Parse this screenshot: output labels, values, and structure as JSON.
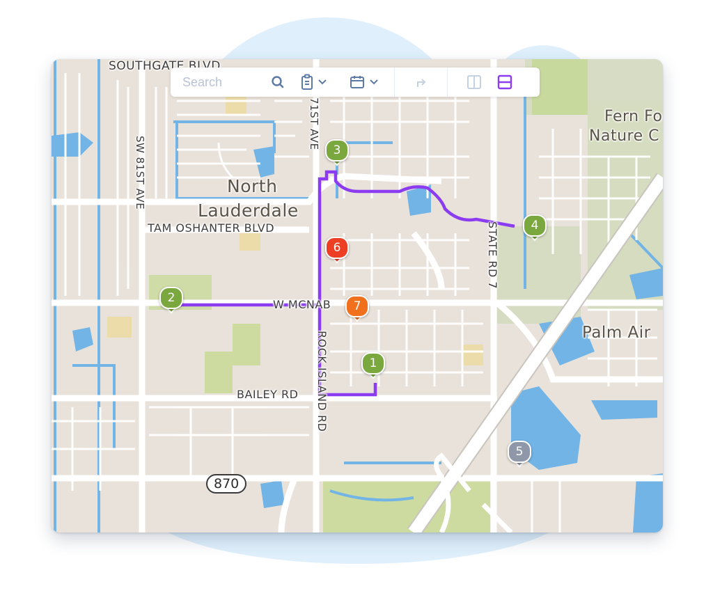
{
  "toolbar": {
    "search_placeholder": "Search",
    "search_value": "",
    "icons": {
      "search": "search-icon",
      "clipboard": "clipboard-icon",
      "calendar": "calendar-icon",
      "redirect": "share-arrow-icon",
      "split_vertical": "columns-icon",
      "split_horizontal": "rows-icon"
    },
    "active_layout": "rows",
    "accent_color": "#8b3cf0",
    "icon_color": "#5b7aa6",
    "disabled_color": "#c3d2e2"
  },
  "map": {
    "labels": {
      "southgate": "SOUTHGATE BLVD",
      "sw81": "SW 81ST AVE",
      "ave71": "71ST AVE",
      "north": "North",
      "lauderdale": "Lauderdale",
      "tamoshanter": "TAM OSHANTER BLVD",
      "wmcnab": "W MCNAB",
      "rockisland": "ROCK ISLAND RD",
      "bailey": "BAILEY RD",
      "staterd7": "STATE RD 7",
      "fern1": "Fern Fo",
      "fern2": "Nature C",
      "palmair": "Palm Air",
      "shield": "870"
    },
    "markers": [
      {
        "id": "1",
        "color": "#7aa83f"
      },
      {
        "id": "2",
        "color": "#7aa83f"
      },
      {
        "id": "3",
        "color": "#7aa83f"
      },
      {
        "id": "4",
        "color": "#7aa83f"
      },
      {
        "id": "5",
        "color": "#8e98a9"
      },
      {
        "id": "6",
        "color": "#ec3f24"
      },
      {
        "id": "7",
        "color": "#f0701d"
      }
    ],
    "route_color": "#8b3cf0"
  }
}
